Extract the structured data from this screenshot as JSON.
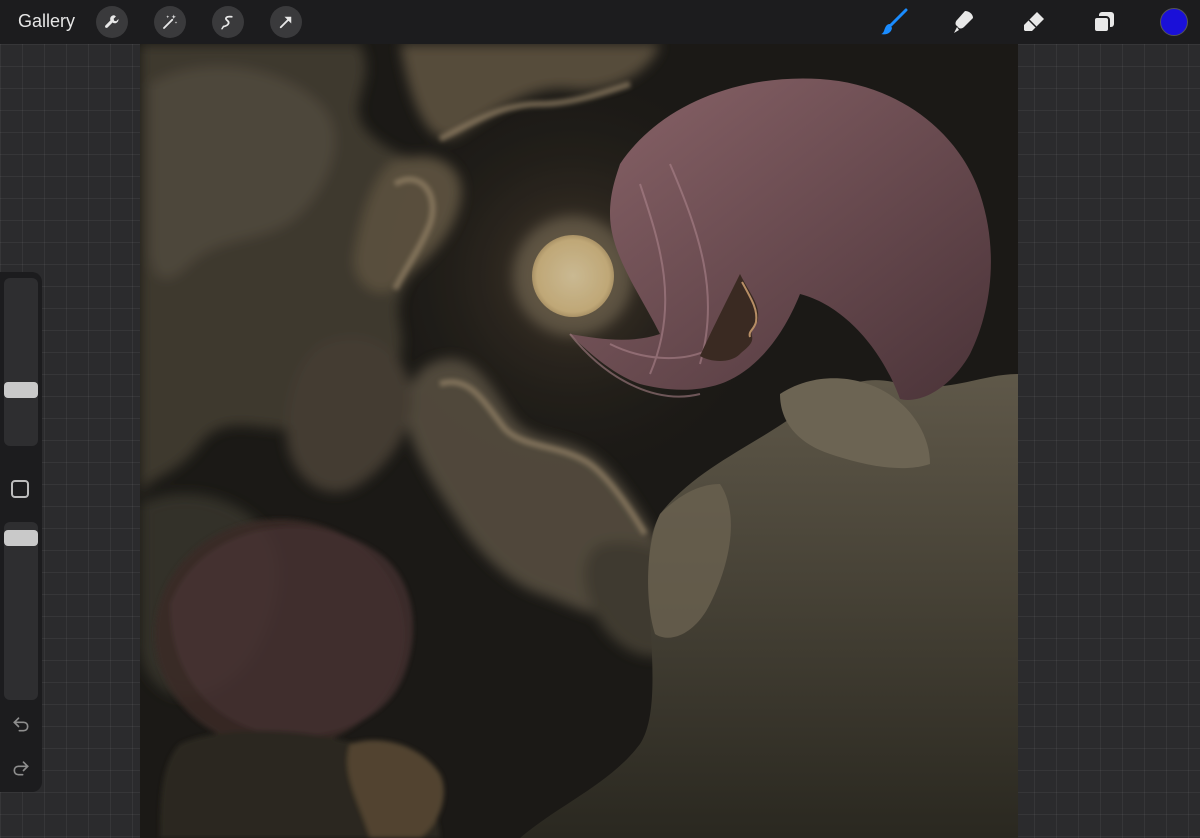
{
  "topbar": {
    "gallery_label": "Gallery",
    "left_tools": [
      "wrench-icon",
      "magic-wand-icon",
      "selection-icon",
      "transform-arrow-icon"
    ],
    "right_tools": [
      "brush-icon",
      "smudge-icon",
      "eraser-icon",
      "layers-icon"
    ],
    "active_tool": "brush-icon",
    "accent_color": "#1a8cff",
    "current_color": "#1a10d8"
  },
  "sidebar": {
    "brush_size_level": 0.25,
    "opacity_level": 0.95,
    "controls": [
      "modify-square-icon",
      "undo-icon",
      "redo-icon"
    ]
  },
  "canvas": {
    "background_color": "#1b1a17"
  }
}
